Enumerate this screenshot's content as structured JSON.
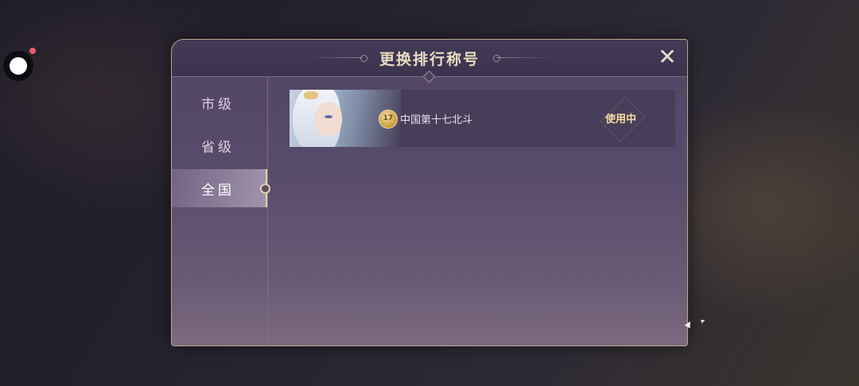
{
  "dialog": {
    "title": "更换排行称号",
    "close_label": "✕"
  },
  "sidebar": {
    "tabs": [
      {
        "label": "市级",
        "active": false
      },
      {
        "label": "省级",
        "active": false
      },
      {
        "label": "全国",
        "active": true
      }
    ]
  },
  "titles": [
    {
      "badge_number": "17",
      "name": "中国第十七北斗",
      "status": "使用中"
    }
  ],
  "colors": {
    "accent_gold": "#f5dca0",
    "panel_purple": "#584c6c",
    "border_gold": "#b9a78a"
  }
}
